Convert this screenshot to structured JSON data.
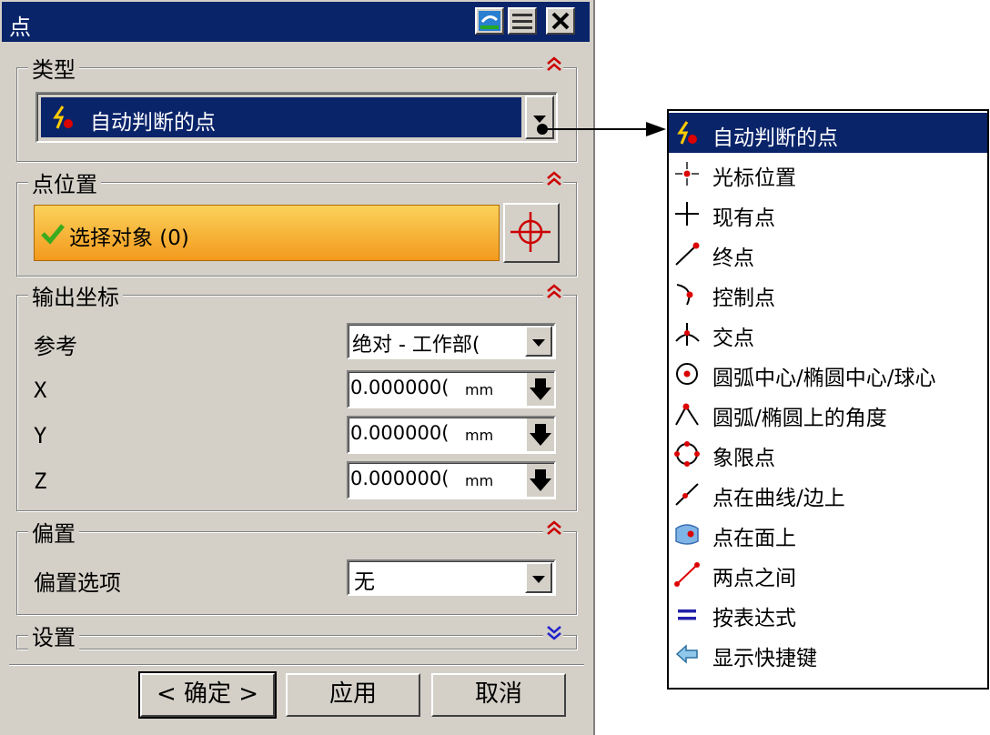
{
  "dialog": {
    "title": "点",
    "sections": {
      "type": {
        "title": "类型",
        "selected": "自动判断的点"
      },
      "point_location": {
        "title": "点位置",
        "select_object": "选择对象 (0)"
      },
      "output_coords": {
        "title": "输出坐标",
        "reference_label": "参考",
        "reference_value": "绝对 - 工作部(",
        "fields": [
          {
            "label": "X",
            "value": "0.000000(",
            "unit": "mm"
          },
          {
            "label": "Y",
            "value": "0.000000(",
            "unit": "mm"
          },
          {
            "label": "Z",
            "value": "0.000000(",
            "unit": "mm"
          }
        ]
      },
      "offset": {
        "title": "偏置",
        "option_label": "偏置选项",
        "option_value": "无"
      },
      "settings": {
        "title": "设置"
      }
    },
    "buttons": {
      "ok": "< 确定 >",
      "apply": "应用",
      "cancel": "取消"
    }
  },
  "dropdown": {
    "items": [
      {
        "label": "自动判断的点",
        "icon": "inferred-point-icon"
      },
      {
        "label": "光标位置",
        "icon": "cursor-location-icon"
      },
      {
        "label": "现有点",
        "icon": "existing-point-icon"
      },
      {
        "label": "终点",
        "icon": "end-point-icon"
      },
      {
        "label": "控制点",
        "icon": "control-point-icon"
      },
      {
        "label": "交点",
        "icon": "intersection-point-icon"
      },
      {
        "label": "圆弧中心/椭圆中心/球心",
        "icon": "arc-center-icon"
      },
      {
        "label": "圆弧/椭圆上的角度",
        "icon": "angle-on-arc-icon"
      },
      {
        "label": "象限点",
        "icon": "quadrant-point-icon"
      },
      {
        "label": "点在曲线/边上",
        "icon": "point-on-curve-icon"
      },
      {
        "label": "点在面上",
        "icon": "point-on-face-icon"
      },
      {
        "label": "两点之间",
        "icon": "between-two-points-icon"
      },
      {
        "label": "按表达式",
        "icon": "by-expression-icon"
      },
      {
        "label": "显示快捷键",
        "icon": "show-shortcuts-icon"
      }
    ]
  },
  "colors": {
    "title_bg": "#0a246a",
    "selection_bg": "#0a246a",
    "select_bar": "#f5a623",
    "accent_red": "#cc0000"
  }
}
